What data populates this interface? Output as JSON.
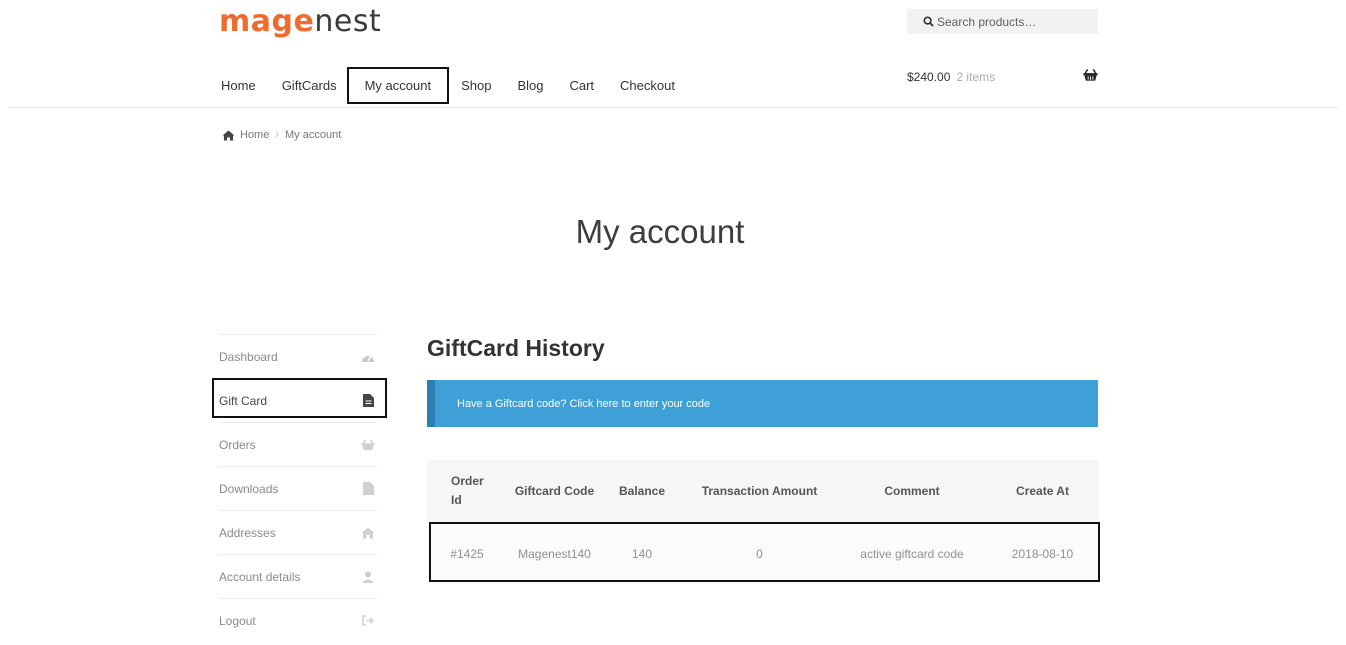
{
  "header": {
    "logo_part1": "mag",
    "logo_part2": "e",
    "logo_part3": "nest",
    "search_placeholder": "Search products…",
    "nav": [
      "Home",
      "GiftCards",
      "My account",
      "Shop",
      "Blog",
      "Cart",
      "Checkout"
    ],
    "cart_amount": "$240.00",
    "cart_count": "2 items",
    "basket_icon": "basket-icon"
  },
  "breadcrumb": {
    "home": "Home",
    "separator": "›",
    "current": "My account"
  },
  "page_title": "My account",
  "sidebar": {
    "items": [
      {
        "label": "Dashboard",
        "icon": "dashboard-icon"
      },
      {
        "label": "Gift Card",
        "icon": "file-icon"
      },
      {
        "label": "Orders",
        "icon": "basket-icon"
      },
      {
        "label": "Downloads",
        "icon": "file-icon"
      },
      {
        "label": "Addresses",
        "icon": "home-icon"
      },
      {
        "label": "Account details",
        "icon": "user-icon"
      },
      {
        "label": "Logout",
        "icon": "logout-icon"
      }
    ]
  },
  "main": {
    "title": "GiftCard History",
    "notice": "Have a Giftcard code? Click here to enter your code",
    "table": {
      "headers": [
        "Order Id",
        "Giftcard Code",
        "Balance",
        "Transaction Amount",
        "Comment",
        "Create At"
      ],
      "rows": [
        [
          "#1425",
          "Magenest140",
          "140",
          "0",
          "active giftcard code",
          "2018-08-10"
        ]
      ]
    }
  },
  "colors": {
    "brand_orange": "#ef6a2c",
    "notice_blue": "#3ea0d6",
    "notice_border": "#2b7fb3"
  }
}
